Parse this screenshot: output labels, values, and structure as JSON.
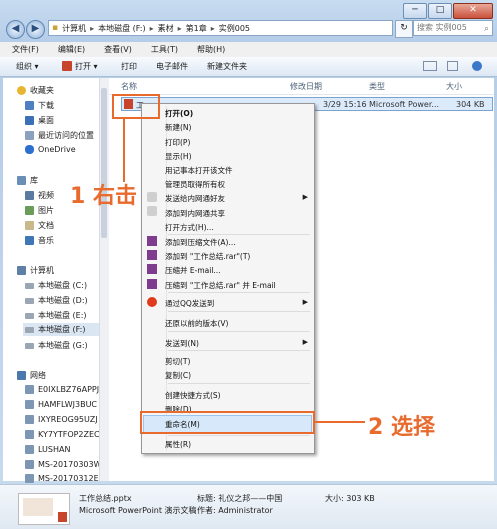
{
  "window": {
    "controls": {
      "minimize": "─",
      "maximize": "□",
      "close": "✕"
    }
  },
  "address": {
    "back_icon": "◀",
    "forward_icon": "▶",
    "crumbs": [
      "计算机",
      "本地磁盘 (F:)",
      "素材",
      "第1章",
      "实例005"
    ],
    "refresh_icon": "↻",
    "search_placeholder": "搜索 实例005"
  },
  "menubar": [
    "文件(F)",
    "编辑(E)",
    "查看(V)",
    "工具(T)",
    "帮助(H)"
  ],
  "toolbar": {
    "organize": "组织 ▾",
    "open": "打开 ▾",
    "print": "打印",
    "email": "电子邮件",
    "new_folder": "新建文件夹"
  },
  "nav": {
    "favorites": "收藏夹",
    "download": "下载",
    "desktop": "桌面",
    "recent": "最近访问的位置",
    "onedrive": "OneDrive",
    "libraries": "库",
    "videos": "视频",
    "pictures": "图片",
    "documents": "文档",
    "music": "音乐",
    "computer": "计算机",
    "drives": [
      "本地磁盘 (C:)",
      "本地磁盘 (D:)",
      "本地磁盘 (E:)",
      "本地磁盘 (F:)",
      "本地磁盘 (G:)"
    ],
    "network": "网络",
    "hosts": [
      "E0IXLBZ76APPJ",
      "HAMFLWJ3BUC",
      "IXYREOG95UZJ",
      "KY7YTFOP2ZEC",
      "LUSHAN",
      "MS-20170303W",
      "MS-20170312E"
    ]
  },
  "columns": {
    "name": "名称",
    "modified": "修改日期",
    "type": "类型",
    "size": "大小"
  },
  "row": {
    "name": "工",
    "modified": "3/29 15:16",
    "type": "Microsoft Power...",
    "size": "304 KB"
  },
  "context_menu": {
    "open": "打开(O)",
    "new": "新建(N)",
    "print": "打印(P)",
    "show": "显示(H)",
    "notepad": "用记事本打开该文件",
    "admin": "管理员取得所有权",
    "send_friend": "发送给内网通好友",
    "add_share": "添加到内网通共享",
    "open_with": "打开方式(H)...",
    "add_archive": "添加到压缩文件(A)...",
    "add_rar": "添加到 \"工作总结.rar\"(T)",
    "compress_email": "压缩并 E-mail...",
    "compress_rar_email": "压缩到 \"工作总结.rar\" 并 E-mail",
    "qq_send": "通过QQ发送到",
    "restore": "还原以前的版本(V)",
    "send_to": "发送到(N)",
    "cut": "剪切(T)",
    "copy": "复制(C)",
    "shortcut": "创建快捷方式(S)",
    "delete": "删除(D)",
    "rename": "重命名(M)",
    "properties": "属性(R)"
  },
  "annotations": {
    "step1": "1 右击",
    "step2": "2 选择"
  },
  "details": {
    "filename": "工作总结.pptx",
    "filetype": "Microsoft PowerPoint 演示文稿",
    "title_label": "标题: 礼仪之邦——中国",
    "author_label": "作者: Administrator",
    "size_label": "大小: 303 KB"
  },
  "colors": {
    "accent": "#e86a2c",
    "selection": "#d6e8fa"
  }
}
